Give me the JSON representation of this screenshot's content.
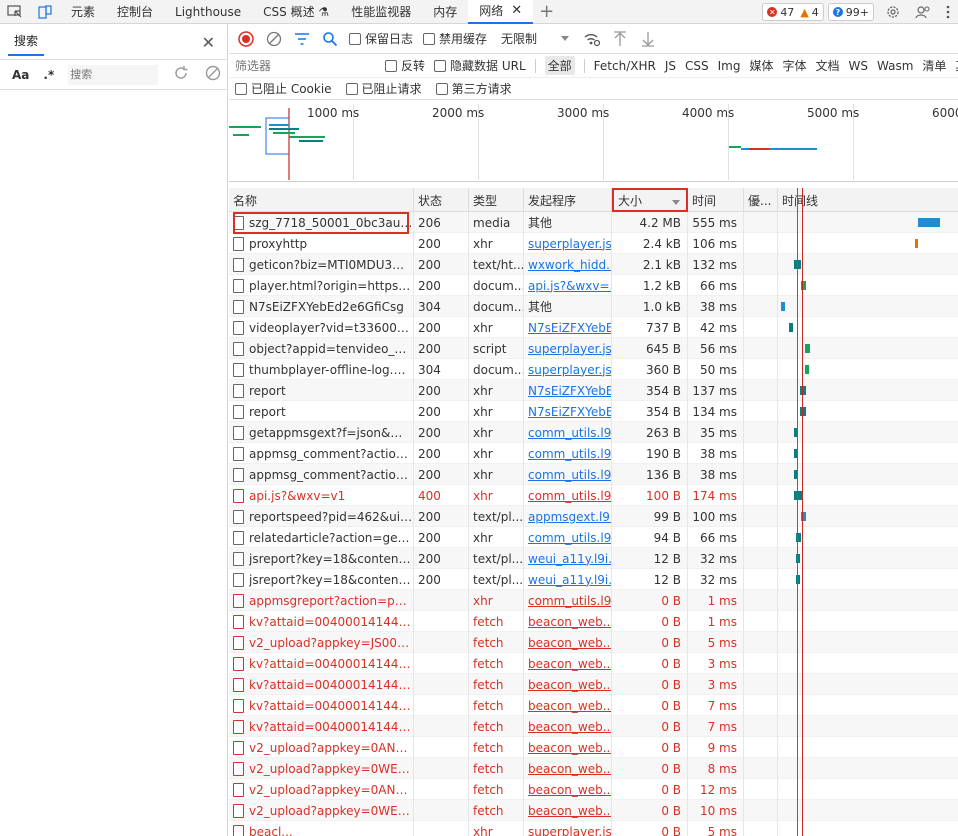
{
  "topbar": {
    "tabs": [
      {
        "label": "元素",
        "active": false
      },
      {
        "label": "控制台",
        "active": false
      },
      {
        "label": "Lighthouse",
        "active": false
      },
      {
        "label": "CSS 概述 ⚗",
        "active": false
      },
      {
        "label": "性能监视器",
        "active": false
      },
      {
        "label": "内存",
        "active": false
      },
      {
        "label": "网络",
        "active": true
      }
    ],
    "close_glyph": "✕",
    "add_glyph": "+",
    "errors": "47",
    "warnings": "4",
    "info": "99+",
    "err_glyph": "✕",
    "warn_glyph": "▲",
    "info_glyph": "?"
  },
  "search_panel": {
    "tab_label": "搜索",
    "close_glyph": "✕",
    "aa": "Aa",
    "regex": ".*",
    "placeholder": "搜索"
  },
  "network": {
    "preserve_log": "保留日志",
    "disable_cache": "禁用缓存",
    "throttle": "无限制",
    "filter_placeholder": "筛选器",
    "invert": "反转",
    "hide_data_urls": "隐藏数据 URL",
    "types": [
      "全部",
      "Fetch/XHR",
      "JS",
      "CSS",
      "Img",
      "媒体",
      "字体",
      "文档",
      "WS",
      "Wasm",
      "清单",
      "其"
    ],
    "blocked_cookies": "已阻止 Cookie",
    "blocked_requests": "已阻止请求",
    "third_party": "第三方请求",
    "overview_ticks": [
      "1000 ms",
      "2000 ms",
      "3000 ms",
      "4000 ms",
      "5000 ms",
      "6000"
    ],
    "columns": {
      "name": "名称",
      "status": "状态",
      "type": "类型",
      "initiator": "发起程序",
      "size": "大小",
      "time": "时间",
      "priority": "優...",
      "waterfall": "时间线"
    },
    "rows": [
      {
        "name": "szg_7718_50001_0bc3auac2...",
        "status": "206",
        "type": "media",
        "initiator": "其他",
        "link": false,
        "size": "4.2 MB",
        "time": "555 ms",
        "red": false,
        "bars": [
          {
            "start": 0.78,
            "width": 0.12,
            "color": "#1a8fd6"
          }
        ]
      },
      {
        "name": "proxyhttp",
        "status": "200",
        "type": "xhr",
        "initiator": "superplayer.js:9",
        "link": true,
        "size": "2.4 kB",
        "time": "106 ms",
        "red": false,
        "bars": [
          {
            "start": 0.76,
            "width": 0.015,
            "color": "#e37400"
          }
        ]
      },
      {
        "name": "geticon?biz=MTI0MDU3ND...",
        "status": "200",
        "type": "text/ht...",
        "initiator": "wxwork_hidd...",
        "link": true,
        "size": "2.1 kB",
        "time": "132 ms",
        "red": false,
        "bars": [
          {
            "start": 0.09,
            "width": 0.04,
            "color": "#0a7f7f"
          }
        ]
      },
      {
        "name": "player.html?origin=https%3...",
        "status": "200",
        "type": "docum...",
        "initiator": "api.js?&wxv=...",
        "link": true,
        "size": "1.2 kB",
        "time": "66 ms",
        "red": false,
        "bars": [
          {
            "start": 0.13,
            "width": 0.025,
            "color": "#1aa35a"
          }
        ]
      },
      {
        "name": "N7sEiZFXYebEd2e6GfiCsg",
        "status": "304",
        "type": "docum...",
        "initiator": "其他",
        "link": false,
        "size": "1.0 kB",
        "time": "38 ms",
        "red": false,
        "bars": [
          {
            "start": 0.015,
            "width": 0.02,
            "color": "#1a8fd6"
          }
        ]
      },
      {
        "name": "videoplayer?vid=t336004g8...",
        "status": "200",
        "type": "xhr",
        "initiator": "N7sEiZFXYebE...",
        "link": true,
        "size": "737 B",
        "time": "42 ms",
        "red": false,
        "bars": [
          {
            "start": 0.06,
            "width": 0.02,
            "color": "#0a7f7f"
          }
        ]
      },
      {
        "name": "object?appid=tenvideo_offl...",
        "status": "200",
        "type": "script",
        "initiator": "superplayer.js:9",
        "link": true,
        "size": "645 B",
        "time": "56 ms",
        "red": false,
        "bars": [
          {
            "start": 0.15,
            "width": 0.025,
            "color": "#1aa35a"
          }
        ]
      },
      {
        "name": "thumbplayer-offline-log.html",
        "status": "304",
        "type": "docum...",
        "initiator": "superplayer.js:9",
        "link": true,
        "size": "360 B",
        "time": "50 ms",
        "red": false,
        "bars": [
          {
            "start": 0.15,
            "width": 0.02,
            "color": "#1aa35a"
          }
        ]
      },
      {
        "name": "report",
        "status": "200",
        "type": "xhr",
        "initiator": "N7sEiZFXYebE...",
        "link": true,
        "size": "354 B",
        "time": "137 ms",
        "red": false,
        "bars": [
          {
            "start": 0.12,
            "width": 0.035,
            "color": "#0a7f7f"
          }
        ]
      },
      {
        "name": "report",
        "status": "200",
        "type": "xhr",
        "initiator": "N7sEiZFXYebE...",
        "link": true,
        "size": "354 B",
        "time": "134 ms",
        "red": false,
        "bars": [
          {
            "start": 0.12,
            "width": 0.035,
            "color": "#0a7f7f"
          }
        ]
      },
      {
        "name": "getappmsgext?f=json&moc...",
        "status": "200",
        "type": "xhr",
        "initiator": "comm_utils.l9...",
        "link": true,
        "size": "263 B",
        "time": "35 ms",
        "red": false,
        "bars": [
          {
            "start": 0.09,
            "width": 0.02,
            "color": "#0a7f7f"
          }
        ]
      },
      {
        "name": "appmsg_comment?action=...",
        "status": "200",
        "type": "xhr",
        "initiator": "comm_utils.l9...",
        "link": true,
        "size": "190 B",
        "time": "38 ms",
        "red": false,
        "bars": [
          {
            "start": 0.09,
            "width": 0.02,
            "color": "#0a7f7f"
          }
        ]
      },
      {
        "name": "appmsg_comment?action=...",
        "status": "200",
        "type": "xhr",
        "initiator": "comm_utils.l9...",
        "link": true,
        "size": "136 B",
        "time": "38 ms",
        "red": false,
        "bars": [
          {
            "start": 0.09,
            "width": 0.02,
            "color": "#0a7f7f"
          }
        ]
      },
      {
        "name": "api.js?&wxv=v1",
        "status": "400",
        "type": "xhr",
        "initiator": "comm_utils.l9...",
        "link": true,
        "size": "100 B",
        "time": "174 ms",
        "red": true,
        "bars": [
          {
            "start": 0.09,
            "width": 0.045,
            "color": "#0a7f7f"
          }
        ]
      },
      {
        "name": "reportspeed?pid=462&uin...",
        "status": "200",
        "type": "text/pl...",
        "initiator": "appmsgext.l9i...",
        "link": true,
        "size": "99 B",
        "time": "100 ms",
        "red": false,
        "bars": [
          {
            "start": 0.13,
            "width": 0.03,
            "color": "#1a8fd6"
          }
        ]
      },
      {
        "name": "relatedarticle?action=getlist...",
        "status": "200",
        "type": "xhr",
        "initiator": "comm_utils.l9...",
        "link": true,
        "size": "94 B",
        "time": "66 ms",
        "red": false,
        "bars": [
          {
            "start": 0.1,
            "width": 0.025,
            "color": "#0a7f7f"
          }
        ]
      },
      {
        "name": "jsreport?key=18&content=t...",
        "status": "200",
        "type": "text/pl...",
        "initiator": "weui_a11y.l9i...",
        "link": true,
        "size": "12 B",
        "time": "32 ms",
        "red": false,
        "bars": [
          {
            "start": 0.1,
            "width": 0.02,
            "color": "#0a7f7f"
          }
        ]
      },
      {
        "name": "jsreport?key=18&content=t...",
        "status": "200",
        "type": "text/pl...",
        "initiator": "weui_a11y.l9i...",
        "link": true,
        "size": "12 B",
        "time": "32 ms",
        "red": false,
        "bars": [
          {
            "start": 0.1,
            "width": 0.02,
            "color": "#0a7f7f"
          }
        ]
      },
      {
        "name": "appmsgreport?action=pag...",
        "status": "",
        "type": "xhr",
        "initiator": "comm_utils.l9...",
        "link": true,
        "size": "0 B",
        "time": "1 ms",
        "red": true,
        "bars": []
      },
      {
        "name": "kv?attaid=00400014144&to...",
        "status": "",
        "type": "fetch",
        "initiator": "beacon_web...",
        "link": true,
        "size": "0 B",
        "time": "1 ms",
        "red": true,
        "bars": []
      },
      {
        "name": "v2_upload?appkey=JS0081L...",
        "status": "",
        "type": "fetch",
        "initiator": "beacon_web...",
        "link": true,
        "size": "0 B",
        "time": "5 ms",
        "red": true,
        "bars": []
      },
      {
        "name": "kv?attaid=00400014144&to...",
        "status": "",
        "type": "fetch",
        "initiator": "beacon_web...",
        "link": true,
        "size": "0 B",
        "time": "3 ms",
        "red": true,
        "bars": []
      },
      {
        "name": "kv?attaid=00400014144&to...",
        "status": "",
        "type": "fetch",
        "initiator": "beacon_web...",
        "link": true,
        "size": "0 B",
        "time": "3 ms",
        "red": true,
        "bars": []
      },
      {
        "name": "kv?attaid=00400014144&to...",
        "status": "",
        "type": "fetch",
        "initiator": "beacon_web...",
        "link": true,
        "size": "0 B",
        "time": "7 ms",
        "red": true,
        "bars": []
      },
      {
        "name": "kv?attaid=00400014144&to...",
        "status": "",
        "type": "fetch",
        "initiator": "beacon_web...",
        "link": true,
        "size": "0 B",
        "time": "7 ms",
        "red": true,
        "bars": []
      },
      {
        "name": "v2_upload?appkey=0AND0...",
        "status": "",
        "type": "fetch",
        "initiator": "beacon_web...",
        "link": true,
        "size": "0 B",
        "time": "9 ms",
        "red": true,
        "bars": []
      },
      {
        "name": "v2_upload?appkey=0WEB0...",
        "status": "",
        "type": "fetch",
        "initiator": "beacon_web...",
        "link": true,
        "size": "0 B",
        "time": "8 ms",
        "red": true,
        "bars": []
      },
      {
        "name": "v2_upload?appkey=0AND0...",
        "status": "",
        "type": "fetch",
        "initiator": "beacon_web...",
        "link": true,
        "size": "0 B",
        "time": "12 ms",
        "red": true,
        "bars": []
      },
      {
        "name": "v2_upload?appkey=0WEB0...",
        "status": "",
        "type": "fetch",
        "initiator": "beacon_web...",
        "link": true,
        "size": "0 B",
        "time": "10 ms",
        "red": true,
        "bars": []
      },
      {
        "name": "beacl...",
        "status": "",
        "type": "xhr",
        "initiator": "superplayer.js:9",
        "link": true,
        "size": "0 B",
        "time": "5 ms",
        "red": true,
        "bars": []
      }
    ]
  }
}
